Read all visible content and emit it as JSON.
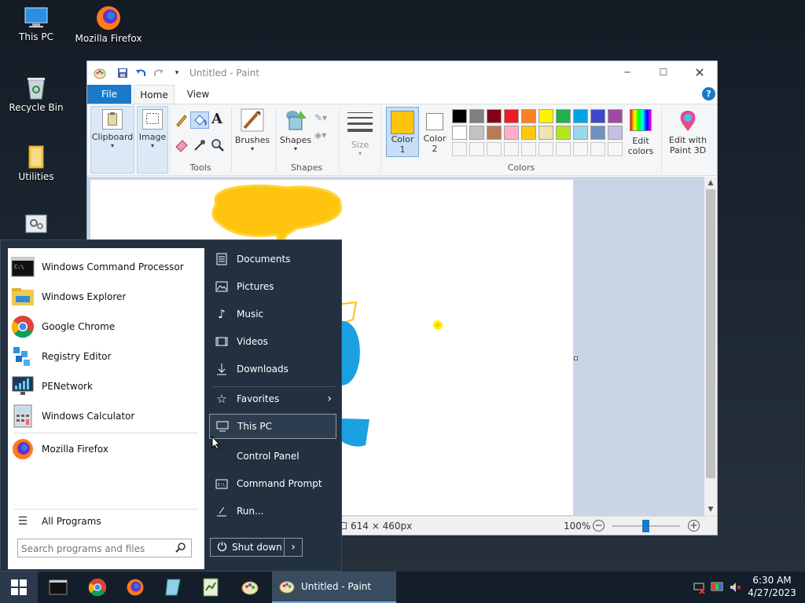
{
  "desktop": {
    "icons": [
      {
        "label": "This PC",
        "icon": "computer-icon"
      },
      {
        "label": "Mozilla Firefox",
        "icon": "firefox-icon"
      },
      {
        "label": "Recycle Bin",
        "icon": "recycle-bin-icon"
      },
      {
        "label": "Utilities",
        "icon": "folder-icon"
      }
    ]
  },
  "paint": {
    "title": "Untitled - Paint",
    "tabs": [
      "File",
      "Home",
      "View"
    ],
    "groups": {
      "clipboard": "Clipboard",
      "image": "Image",
      "tools": "Tools",
      "brushes": "Brushes",
      "shapes": "Shapes",
      "shapes_group": "Shapes",
      "size": "Size",
      "color1_line1": "Color",
      "color1_line2": "1",
      "color2_line1": "Color",
      "color2_line2": "2",
      "colors": "Colors",
      "edit_colors_line1": "Edit",
      "edit_colors_line2": "colors",
      "paint3d_line1": "Edit with",
      "paint3d_line2": "Paint 3D"
    },
    "color1": "#ffc40e",
    "color2": "#ffffff",
    "palette_row1": [
      "#000000",
      "#7f7f7f",
      "#880015",
      "#ed1c24",
      "#ff7f27",
      "#fff200",
      "#22b14c",
      "#00a2e8",
      "#3f48cc",
      "#a349a4"
    ],
    "palette_row2": [
      "#ffffff",
      "#c3c3c3",
      "#b97a57",
      "#ffaec9",
      "#ffc90e",
      "#efe4b0",
      "#b5e61d",
      "#99d9ea",
      "#7092be",
      "#c8bfe7"
    ],
    "status": {
      "dimensions": "614 × 460px",
      "zoom": "100%"
    }
  },
  "start_menu": {
    "programs": [
      {
        "label": "Windows Command Processor",
        "icon": "cmd-icon"
      },
      {
        "label": "Windows Explorer",
        "icon": "explorer-icon"
      },
      {
        "label": "Google Chrome",
        "icon": "chrome-icon"
      },
      {
        "label": "Registry Editor",
        "icon": "registry-icon"
      },
      {
        "label": "PENetwork",
        "icon": "network-icon"
      },
      {
        "label": "Windows Calculator",
        "icon": "calculator-icon"
      },
      {
        "label": "Mozilla Firefox",
        "icon": "firefox-icon"
      }
    ],
    "all_programs": "All Programs",
    "search_placeholder": "Search programs and files",
    "right_items": [
      {
        "label": "Documents",
        "icon": "documents-icon"
      },
      {
        "label": "Pictures",
        "icon": "pictures-icon"
      },
      {
        "label": "Music",
        "icon": "music-icon"
      },
      {
        "label": "Videos",
        "icon": "videos-icon"
      },
      {
        "label": "Downloads",
        "icon": "downloads-icon"
      },
      {
        "label": "Favorites",
        "icon": "star-icon"
      },
      {
        "label": "This PC",
        "icon": "computer-icon"
      },
      {
        "label": "Control Panel",
        "icon": "control-panel-icon"
      },
      {
        "label": "Command Prompt",
        "icon": "cmd-icon"
      },
      {
        "label": "Run...",
        "icon": "run-icon"
      }
    ],
    "shutdown": "Shut down"
  },
  "taskbar": {
    "active_window": "Untitled - Paint",
    "time": "6:30 AM",
    "date": "4/27/2023"
  }
}
